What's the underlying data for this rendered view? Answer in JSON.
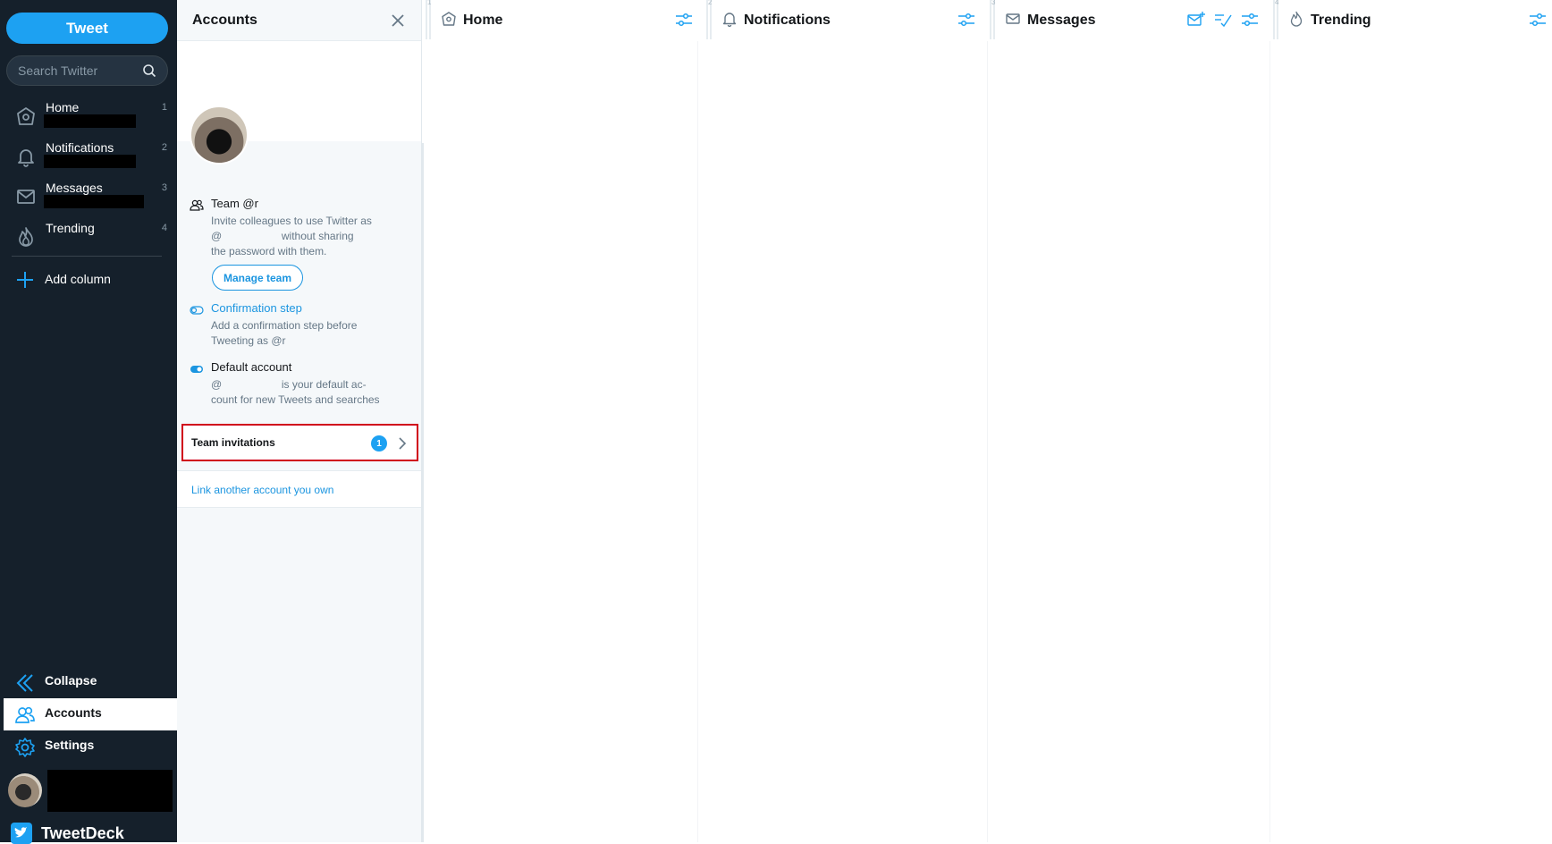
{
  "nav": {
    "tweet_label": "Tweet",
    "search_placeholder": "Search Twitter",
    "items": [
      {
        "label": "Home",
        "num": "1",
        "icon": "home-icon"
      },
      {
        "label": "Notifications",
        "num": "2",
        "icon": "bell-icon"
      },
      {
        "label": "Messages",
        "num": "3",
        "icon": "envelope-icon"
      },
      {
        "label": "Trending",
        "num": "4",
        "icon": "flame-icon"
      }
    ],
    "add_column": "Add column",
    "collapse": "Collapse",
    "accounts": "Accounts",
    "settings": "Settings",
    "brand": "TweetDeck"
  },
  "drawer": {
    "title": "Accounts",
    "team": {
      "title": "Team @r",
      "desc_1": "Invite colleagues to use Twitter as",
      "desc_2": "@                    without sharing",
      "desc_3": "the password with them.",
      "button": "Manage team"
    },
    "confirmation": {
      "title": "Confirmation step",
      "desc_1": "Add a confirmation step before",
      "desc_2": "Tweeting as @r"
    },
    "default_account": {
      "title": "Default account",
      "desc_1": "@                    is your default ac-",
      "desc_2": "count for new Tweets and searches"
    },
    "team_invitations": {
      "label": "Team invitations",
      "count": "1"
    },
    "link_account": "Link another account you own"
  },
  "columns": [
    {
      "num": "1",
      "title": "Home",
      "icon": "home-icon"
    },
    {
      "num": "2",
      "title": "Notifications",
      "icon": "bell-icon"
    },
    {
      "num": "3",
      "title": "Messages",
      "icon": "envelope-icon"
    },
    {
      "num": "4",
      "title": "Trending",
      "icon": "flame-icon"
    }
  ],
  "colors": {
    "accent": "#1da1f2",
    "nav_bg": "#15202b",
    "highlight": "#d0021b"
  }
}
